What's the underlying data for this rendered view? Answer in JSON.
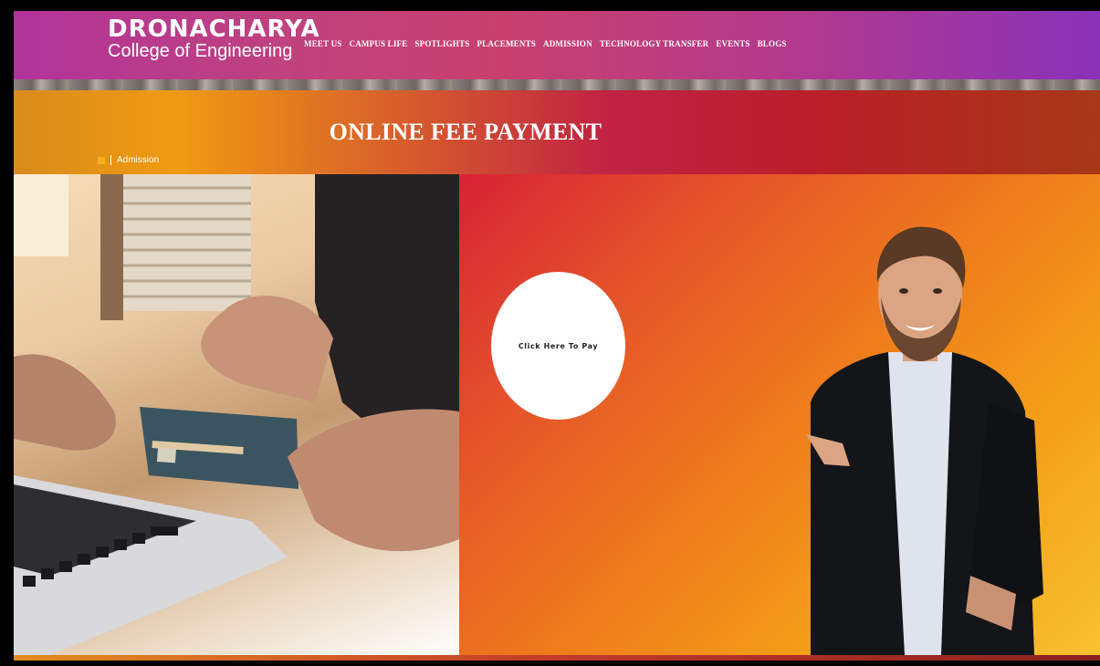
{
  "header": {
    "logo_title": "DRONACHARYA",
    "logo_subtitle": "College of Engineering",
    "nav": [
      "MEET US",
      "CAMPUS LIFE",
      "SPOTLIGHTS",
      "PLACEMENTS",
      "ADMISSION",
      "TECHNOLOGY TRANSFER",
      "EVENTS",
      "BLOGS"
    ]
  },
  "banner": {
    "title": "ONLINE FEE PAYMENT",
    "breadcrumb": "Admission"
  },
  "main": {
    "pay_button_label": "Click Here To Pay"
  },
  "colors": {
    "header_purple": "#b0349a",
    "banner_orange": "#f09a12",
    "banner_red": "#c02244",
    "panel_orange": "#ee7a1c"
  }
}
